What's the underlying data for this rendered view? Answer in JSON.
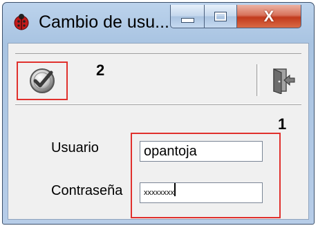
{
  "window": {
    "title": "Cambio de usu...",
    "controls": {
      "close_glyph": "X"
    }
  },
  "toolbar": {
    "accept_icon": "check-circle-icon",
    "exit_icon": "exit-door-icon",
    "annotation_2": "2"
  },
  "form": {
    "annotation_1": "1",
    "user_label": "Usuario",
    "user_value": "opantoja",
    "password_label": "Contraseña",
    "password_value": "xxxxxxxx"
  },
  "colors": {
    "highlight": "#e0302c",
    "titlebar": "#b7cde8",
    "close_button": "#c23a1d"
  }
}
